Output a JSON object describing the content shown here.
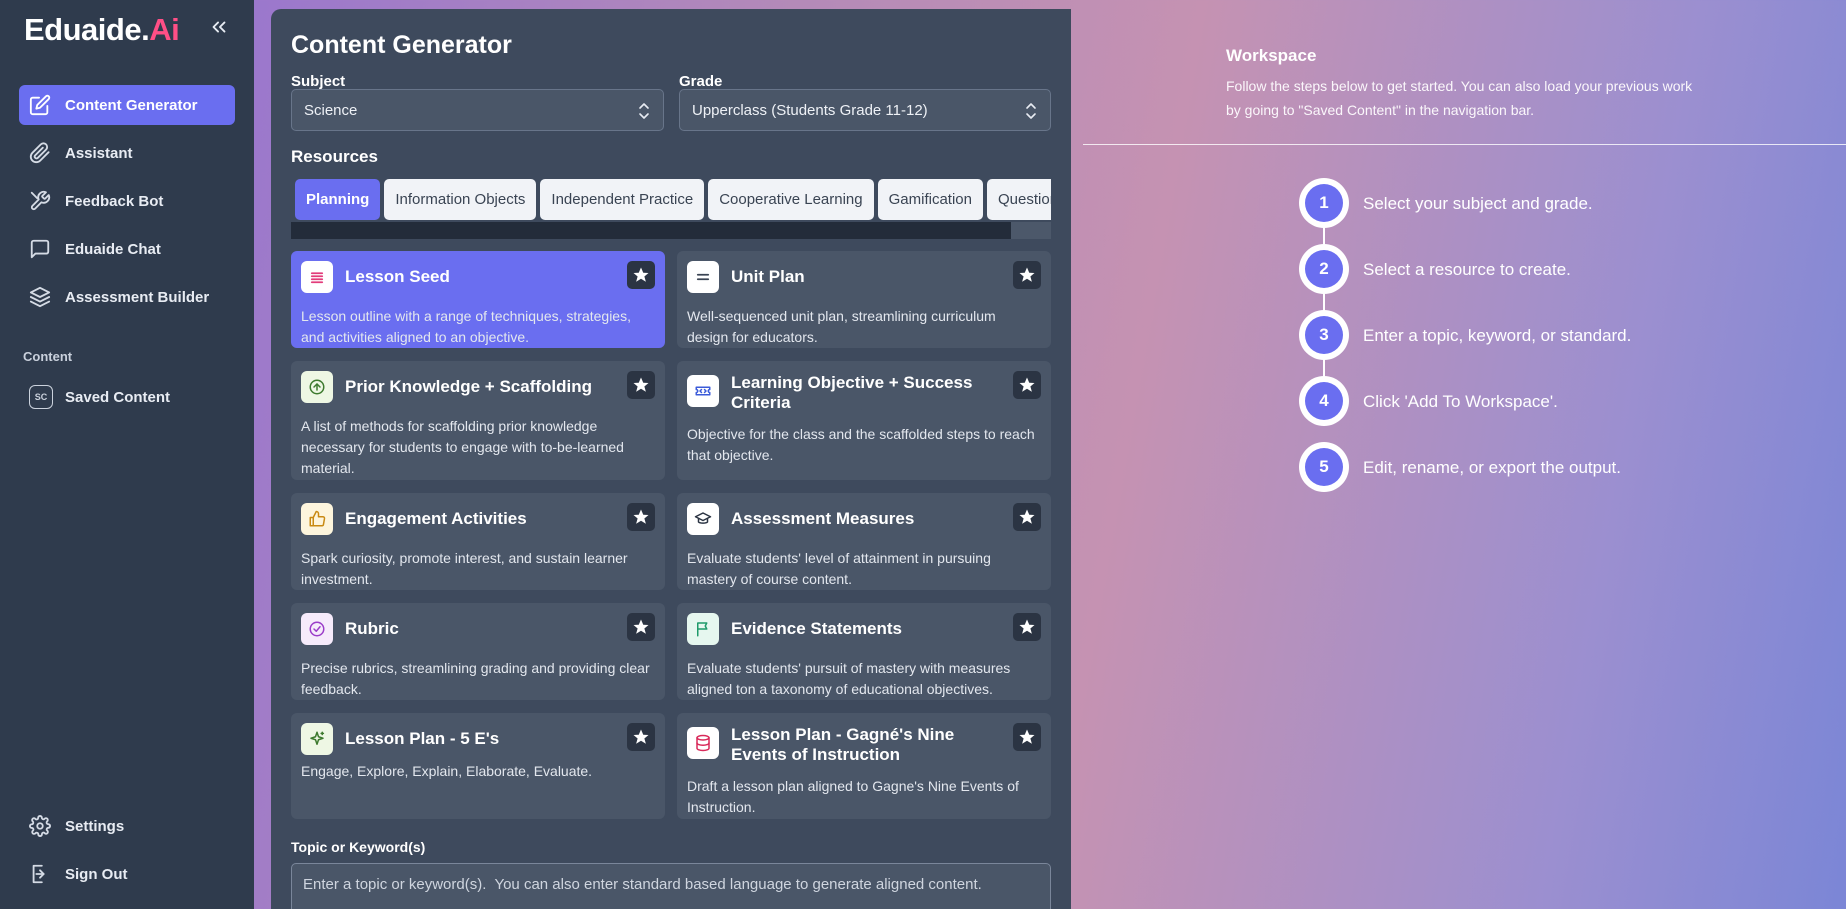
{
  "brand": {
    "part1": "Eduaide.",
    "part2": "Ai"
  },
  "sidebar": {
    "items": [
      {
        "label": "Content Generator",
        "icon": "edit-icon",
        "active": true
      },
      {
        "label": "Assistant",
        "icon": "paperclip-icon"
      },
      {
        "label": "Feedback Bot",
        "icon": "tools-icon"
      },
      {
        "label": "Eduaide Chat",
        "icon": "chat-icon"
      },
      {
        "label": "Assessment Builder",
        "icon": "layers-icon"
      }
    ],
    "section_label": "Content",
    "saved": {
      "badge": "SC",
      "label": "Saved Content"
    },
    "settings_label": "Settings",
    "signout_label": "Sign Out"
  },
  "main": {
    "title": "Content Generator",
    "subject": {
      "label": "Subject",
      "value": "Science"
    },
    "grade": {
      "label": "Grade",
      "value": "Upperclass (Students Grade 11-12)"
    },
    "resources_label": "Resources",
    "tabs": [
      {
        "label": "Planning",
        "active": true
      },
      {
        "label": "Information Objects"
      },
      {
        "label": "Independent Practice"
      },
      {
        "label": "Cooperative Learning"
      },
      {
        "label": "Gamification"
      },
      {
        "label": "Questions"
      }
    ],
    "cards": [
      {
        "title": "Lesson Seed",
        "desc": "Lesson outline with a range of techniques, strategies, and activities aligned to an objective.",
        "icon": "list-icon",
        "icon_color": "#e23c7a",
        "active": true
      },
      {
        "title": "Unit Plan",
        "desc": "Well-sequenced unit plan, streamlining curriculum design for educators.",
        "icon": "equals-icon",
        "icon_color": "#3a4453"
      },
      {
        "title": "Prior Knowledge + Scaffolding",
        "desc": "A list of methods for scaffolding prior knowledge necessary for students to engage with to-be-learned material.",
        "icon": "arrow-up-circle-icon",
        "icon_color": "#3d7a2e"
      },
      {
        "title": "Learning Objective + Success Criteria",
        "desc": "Objective for the class and the scaffolded steps to reach that objective.",
        "icon": "ticket-icon",
        "icon_color": "#3b5bd9"
      },
      {
        "title": "Engagement Activities",
        "desc": "Spark curiosity, promote interest, and sustain learner investment.",
        "icon": "thumbs-up-icon",
        "icon_color": "#c98a14"
      },
      {
        "title": "Assessment Measures",
        "desc": "Evaluate students' level of attainment in pursuing mastery of course content.",
        "icon": "graduation-cap-icon",
        "icon_color": "#2b3443"
      },
      {
        "title": "Rubric",
        "desc": "Precise rubrics, streamlining grading and providing clear feedback.",
        "icon": "check-circle-icon",
        "icon_color": "#9b3dc9"
      },
      {
        "title": "Evidence Statements",
        "desc": "Evaluate students' pursuit of mastery with measures aligned ton a taxonomy of educational objectives.",
        "icon": "flag-icon",
        "icon_color": "#1f9a6a"
      },
      {
        "title": "Lesson Plan - 5 E's",
        "desc": "Engage, Explore, Explain, Elaborate, Evaluate.",
        "icon": "sparkle-icon",
        "icon_color": "#3d7a2e"
      },
      {
        "title": "Lesson Plan - Gagné's Nine Events of Instruction",
        "desc": "Draft a lesson plan aligned to Gagne's Nine Events of Instruction.",
        "icon": "database-icon",
        "icon_color": "#d92a5a"
      }
    ],
    "topic": {
      "label": "Topic or Keyword(s)",
      "placeholder": "Enter a topic or keyword(s).  You can also enter standard based language to generate aligned content."
    }
  },
  "workspace": {
    "title": "Workspace",
    "desc": "Follow the steps below to get started. You can also load your previous work by going to \"Saved Content\" in the navigation bar.",
    "steps": [
      {
        "num": "1",
        "text": "Select your subject and grade."
      },
      {
        "num": "2",
        "text": "Select a resource to create."
      },
      {
        "num": "3",
        "text": "Enter a topic, keyword, or standard."
      },
      {
        "num": "4",
        "text": "Click 'Add To Workspace'."
      },
      {
        "num": "5",
        "text": "Edit, rename, or export the output."
      }
    ]
  }
}
